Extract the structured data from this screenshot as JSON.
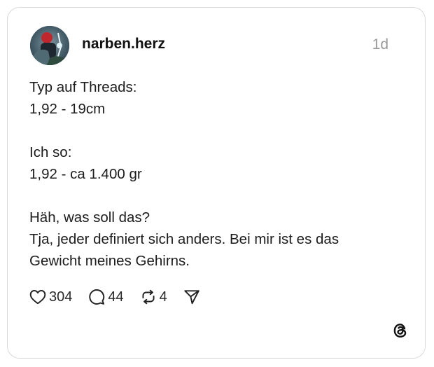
{
  "post": {
    "author": {
      "username": "narben.herz",
      "avatar_icon": "profile-photo"
    },
    "timestamp": "1d",
    "lines": [
      "Typ auf Threads:",
      "1,92 - 19cm",
      "",
      "Ich so:",
      "1,92 - ca 1.400 gr",
      "",
      "Häh, was soll das?",
      "Tja, jeder definiert sich anders. Bei mir ist es das",
      "Gewicht meines Gehirns."
    ],
    "actions": {
      "like_count": "304",
      "comment_count": "44",
      "repost_count": "4"
    }
  },
  "icons": {
    "like": "heart-icon",
    "comment": "speech-bubble-icon",
    "repost": "repost-arrows-icon",
    "share": "send-paper-plane-icon",
    "brand": "threads-logo"
  },
  "colors": {
    "text": "#1c1c1c",
    "muted": "#999999",
    "border": "#d9d9d9"
  }
}
